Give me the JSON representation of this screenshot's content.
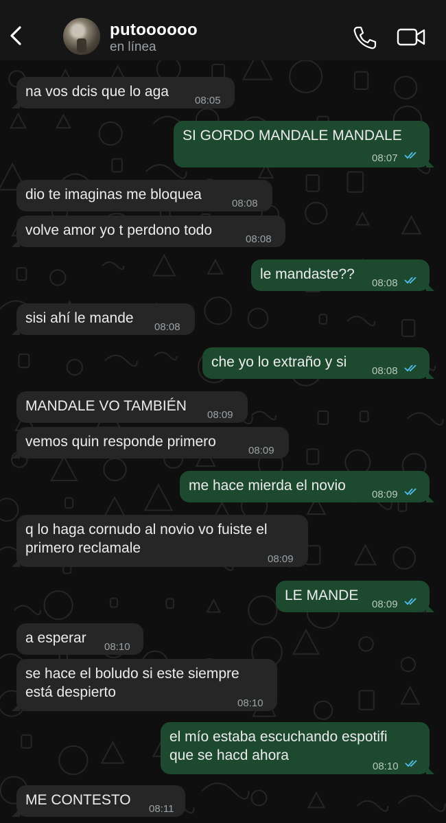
{
  "header": {
    "contact_name": "putoooooo",
    "status": "en línea",
    "icons": {
      "back": "chevron-left-icon",
      "call": "phone-icon",
      "video": "video-camera-icon"
    }
  },
  "colors": {
    "incoming_bubble": "#262626",
    "outgoing_bubble": "#1d4a2f",
    "read_ticks": "#53bdeb",
    "background": "#0f0f0f"
  },
  "messages": [
    {
      "dir": "in",
      "lines": [
        "na vos dcis que lo aga"
      ],
      "time": "08:05"
    },
    {
      "dir": "out",
      "lines": [
        "SI GORDO MANDALE MANDALE"
      ],
      "time": "08:07",
      "read": true
    },
    {
      "dir": "in",
      "lines": [
        "dio te imaginas me bloquea"
      ],
      "time": "08:08"
    },
    {
      "dir": "in",
      "lines": [
        "volve amor yo t perdono todo"
      ],
      "time": "08:08"
    },
    {
      "dir": "out",
      "lines": [
        "le mandaste??"
      ],
      "time": "08:08",
      "read": true
    },
    {
      "dir": "in",
      "lines": [
        "sisi ahí le mande"
      ],
      "time": "08:08"
    },
    {
      "dir": "out",
      "lines": [
        "che yo lo extraño y si"
      ],
      "time": "08:08",
      "read": true
    },
    {
      "dir": "in",
      "lines": [
        "MANDALE VO TAMBIÉN"
      ],
      "time": "08:09"
    },
    {
      "dir": "in",
      "lines": [
        "vemos quin responde primero"
      ],
      "time": "08:09"
    },
    {
      "dir": "out",
      "lines": [
        "me hace mierda el novio"
      ],
      "time": "08:09",
      "read": true
    },
    {
      "dir": "in",
      "lines": [
        "q lo haga cornudo al novio vo fuiste el",
        "primero reclamale"
      ],
      "time": "08:09"
    },
    {
      "dir": "out",
      "lines": [
        "LE MANDE"
      ],
      "time": "08:09",
      "read": true
    },
    {
      "dir": "in",
      "lines": [
        "a esperar"
      ],
      "time": "08:10"
    },
    {
      "dir": "in",
      "lines": [
        "se hace el boludo si este siempre",
        "está despierto"
      ],
      "time": "08:10"
    },
    {
      "dir": "out",
      "lines": [
        "el mío estaba escuchando espotifi",
        "que se hacd ahora"
      ],
      "time": "08:10",
      "read": true
    },
    {
      "dir": "in",
      "lines": [
        "ME CONTESTO"
      ],
      "time": "08:11"
    }
  ]
}
